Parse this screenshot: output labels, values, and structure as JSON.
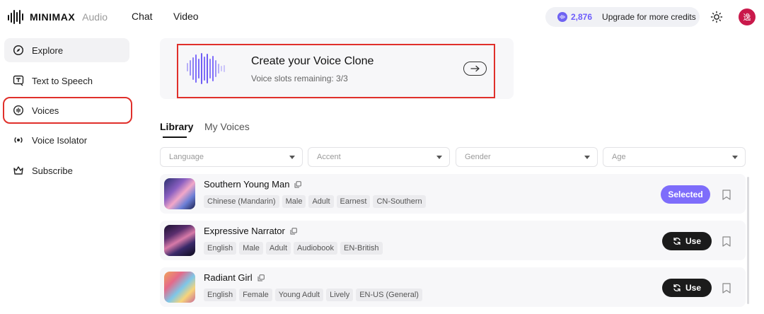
{
  "header": {
    "brand": "MINIMAX",
    "product": "Audio",
    "nav": [
      "Chat",
      "Video"
    ],
    "credits_amount": "2,876",
    "upgrade_label": "Upgrade for more credits",
    "avatar_initial": "逸"
  },
  "sidebar": {
    "items": [
      {
        "label": "Explore",
        "icon": "compass-icon"
      },
      {
        "label": "Text to Speech",
        "icon": "text-to-speech-icon"
      },
      {
        "label": "Voices",
        "icon": "voice-icon",
        "active": true
      },
      {
        "label": "Voice Isolator",
        "icon": "isolator-icon"
      },
      {
        "label": "Subscribe",
        "icon": "crown-icon"
      }
    ]
  },
  "banner": {
    "title": "Create your Voice Clone",
    "subtitle": "Voice slots remaining: 3/3"
  },
  "tabs": [
    "Library",
    "My Voices"
  ],
  "filters": [
    {
      "placeholder": "Language"
    },
    {
      "placeholder": "Accent"
    },
    {
      "placeholder": "Gender"
    },
    {
      "placeholder": "Age"
    }
  ],
  "voices": [
    {
      "name": "Southern Young Man",
      "tags": [
        "Chinese (Mandarin)",
        "Male",
        "Adult",
        "Earnest",
        "CN-Southern"
      ],
      "action": "Selected"
    },
    {
      "name": "Expressive Narrator",
      "tags": [
        "English",
        "Male",
        "Adult",
        "Audiobook",
        "EN-British"
      ],
      "action": "Use"
    },
    {
      "name": "Radiant Girl",
      "tags": [
        "English",
        "Female",
        "Young Adult",
        "Lively",
        "EN-US (General)"
      ],
      "action": "Use"
    }
  ],
  "colors": {
    "accent": "#7e6dfb",
    "highlight_box": "#e0302b",
    "avatar": "#c9194b"
  }
}
